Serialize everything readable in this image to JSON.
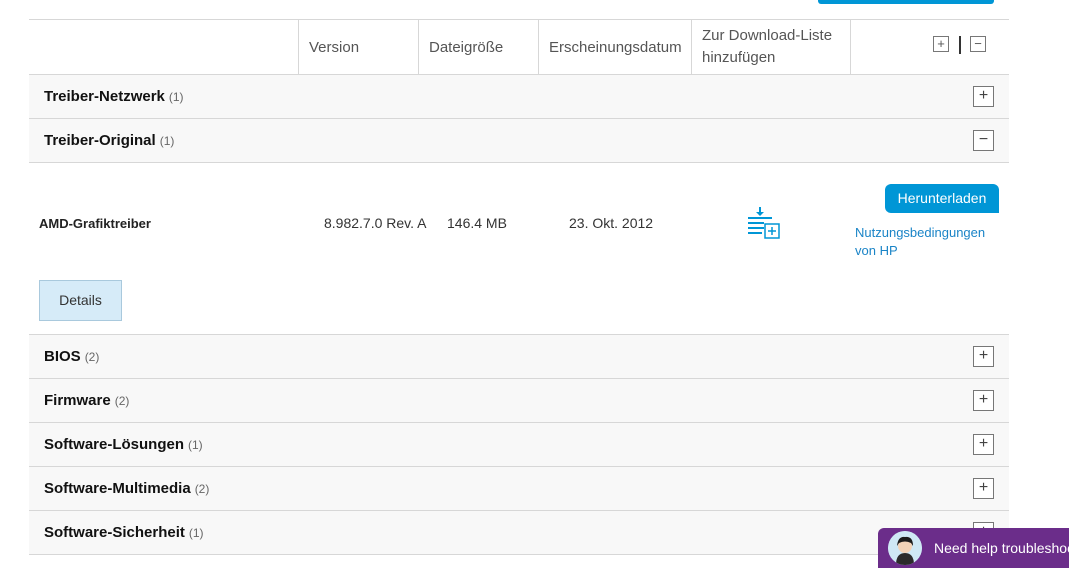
{
  "table": {
    "headers": {
      "version": "Version",
      "size": "Dateigröße",
      "date": "Erscheinungsdatum",
      "add_list_line1": "Zur Download-Liste",
      "add_list_line2": "hinzufügen"
    },
    "expand_all_icon": "plus-box-icon",
    "collapse_all_icon": "minus-box-icon"
  },
  "categories": [
    {
      "name": "Treiber-Netzwerk",
      "count": "(1)",
      "state": "collapsed"
    },
    {
      "name": "Treiber-Original",
      "count": "(1)",
      "state": "expanded"
    },
    {
      "name": "BIOS",
      "count": "(2)",
      "state": "collapsed"
    },
    {
      "name": "Firmware",
      "count": "(2)",
      "state": "collapsed"
    },
    {
      "name": "Software-Lösungen",
      "count": "(1)",
      "state": "collapsed"
    },
    {
      "name": "Software-Multimedia",
      "count": "(2)",
      "state": "collapsed"
    },
    {
      "name": "Software-Sicherheit",
      "count": "(1)",
      "state": "collapsed"
    }
  ],
  "toggle_symbols": {
    "collapsed": "+",
    "expanded": "−"
  },
  "driver": {
    "name": "AMD-Grafiktreiber",
    "version": "8.982.7.0 Rev. A",
    "size": "146.4 MB",
    "date": "23. Okt. 2012",
    "add_icon": "add-to-download-list-icon",
    "download_label": "Herunterladen",
    "terms_line1": "Nutzungsbedingungen",
    "terms_line2": "von HP",
    "details_label": "Details"
  },
  "help": {
    "label": "Need help troubleshoo",
    "avatar_icon": "assistant-avatar-icon"
  },
  "colors": {
    "accent": "#0096d6",
    "link": "#1a84c7",
    "help_bg": "#6b2d8a",
    "row_bg": "#f8f8f8",
    "border": "#d7d7d7"
  }
}
